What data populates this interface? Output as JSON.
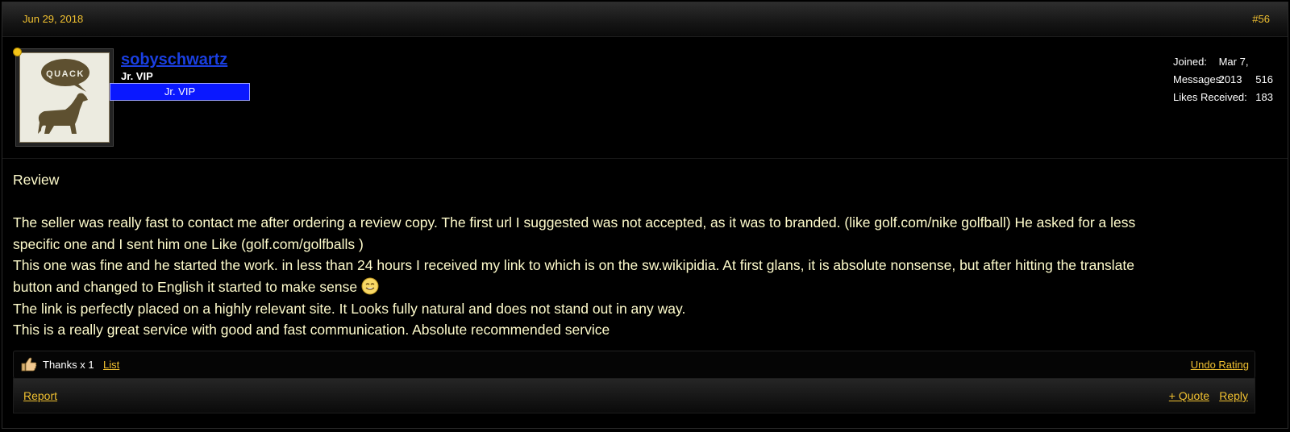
{
  "post": {
    "date": "Jun 29, 2018",
    "number": "#56"
  },
  "user": {
    "name": "sobyschwartz",
    "title": "Jr. VIP",
    "banner": "Jr. VIP",
    "avatar_icon": "quack-dog-avatar",
    "avatar_text": "QUACK",
    "online_status_color": "#f5c518"
  },
  "stats": {
    "joined_label": "Joined:",
    "joined_value": "Mar 7, 2013",
    "messages_label": "Messages:",
    "messages_value": "516",
    "likes_label": "Likes Received:",
    "likes_value": "183"
  },
  "message": {
    "heading": "Review",
    "lines": [
      "The seller was really fast to contact me after ordering a review copy. The first url I suggested was not accepted, as it was to branded. (like golf.com/nike golfball) He asked for a less",
      "specific one and I sent him one Like (golf.com/golfballs )",
      "This one was fine and he started the work. in less than 24 hours I received my link to which is on the sw.wikipidia. At first glans, it is absolute nonsense, but after hitting the translate",
      "button and changed to English it started to make sense",
      "The link is perfectly placed on a highly relevant site. It Looks fully natural and does not stand out in any way.",
      "This is a really great service with good and fast communication. Absolute recommended service"
    ],
    "smiley_icon": "smile-icon"
  },
  "rating": {
    "icon": "thumbs-up-icon",
    "thanks_text": "Thanks x 1",
    "list_label": "List",
    "undo_label": "Undo Rating"
  },
  "footer": {
    "report_label": "Report",
    "quote_label": "+ Quote",
    "reply_label": "Reply"
  },
  "colors": {
    "link_gold": "#f0c030",
    "username_blue": "#1a3fe0",
    "banner_blue": "#0a18ff",
    "message_text": "#fffccc"
  }
}
